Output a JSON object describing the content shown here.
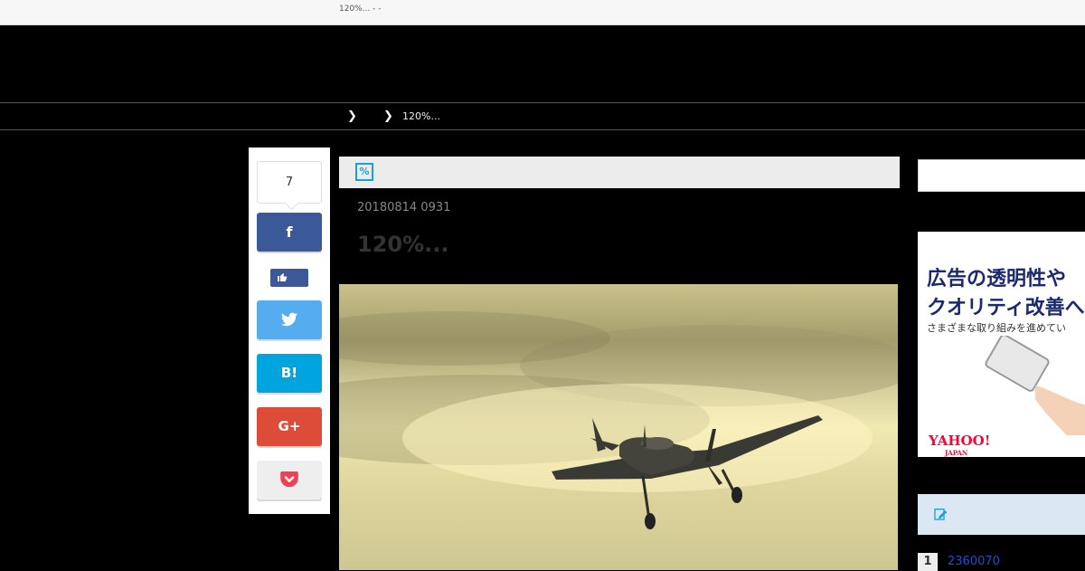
{
  "browser": {
    "tab_title": "120%... - -"
  },
  "breadcrumb": {
    "current": "120%..."
  },
  "share": {
    "count": "7",
    "facebook_icon": "f",
    "like_icon": "thumbs-up-icon",
    "twitter_icon": "twitter-bird-icon",
    "hatena_label": "B!",
    "gplus_label": "G+",
    "pocket_icon": "pocket-icon",
    "colors": {
      "facebook": "#3b5998",
      "twitter": "#55acee",
      "hatena": "#00a4de",
      "gplus": "#dd4b39",
      "pocket": "#ef4056"
    }
  },
  "article": {
    "category_icon": "%",
    "date": "20180814 0931",
    "title": "120%..."
  },
  "ad": {
    "line1": "広告の透明性や",
    "line2": "クオリティ改善へ",
    "line3": "さまざまな取り組みを進めてい",
    "logo": "YAHOO!",
    "logo_sub": "JAPAN"
  },
  "ranking": {
    "items": [
      {
        "rank": "1",
        "label": "2360070"
      }
    ]
  }
}
